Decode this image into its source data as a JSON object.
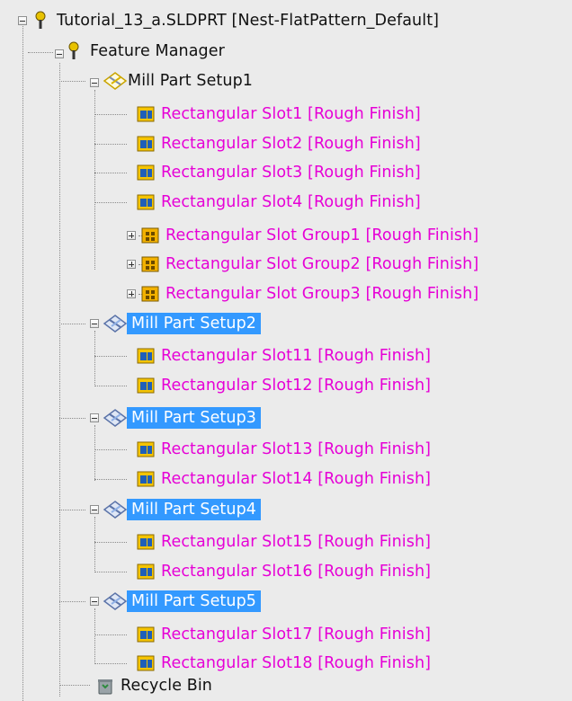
{
  "tree": {
    "root_label": "Tutorial_13_a.SLDPRT [Nest-FlatPattern_Default]",
    "feature_manager_label": "Feature Manager",
    "setup1": {
      "label": "Mill Part Setup1",
      "children": [
        "Rectangular Slot1 [Rough Finish]",
        "Rectangular Slot2 [Rough Finish]",
        "Rectangular Slot3 [Rough Finish]",
        "Rectangular Slot4 [Rough Finish]",
        "Rectangular Slot Group1 [Rough Finish]",
        "Rectangular Slot Group2 [Rough Finish]",
        "Rectangular Slot Group3 [Rough Finish]"
      ]
    },
    "setup2": {
      "label": "Mill Part Setup2",
      "children": [
        "Rectangular Slot11 [Rough Finish]",
        "Rectangular Slot12 [Rough Finish]"
      ]
    },
    "setup3": {
      "label": "Mill Part Setup3",
      "children": [
        "Rectangular Slot13 [Rough Finish]",
        "Rectangular Slot14 [Rough Finish]"
      ]
    },
    "setup4": {
      "label": "Mill Part Setup4",
      "children": [
        "Rectangular Slot15 [Rough Finish]",
        "Rectangular Slot16 [Rough Finish]"
      ]
    },
    "setup5": {
      "label": "Mill Part Setup5",
      "children": [
        "Rectangular Slot17 [Rough Finish]",
        "Rectangular Slot18 [Rough Finish]"
      ]
    },
    "recycle_bin_label": "Recycle Bin"
  },
  "colors": {
    "background": "#ebebeb",
    "operation_text": "#e600d6",
    "selection_bg": "#3399ff",
    "selection_text": "#ffffff",
    "normal_text": "#111111"
  }
}
